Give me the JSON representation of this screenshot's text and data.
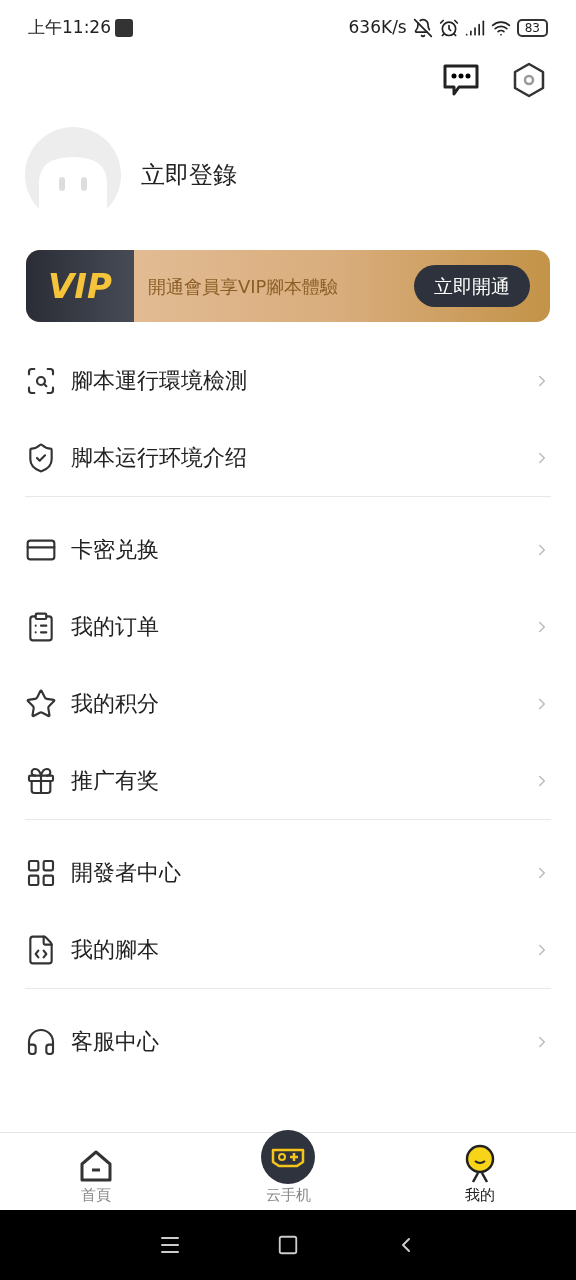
{
  "status_bar": {
    "time": "上午11:26",
    "speed": "636K/s",
    "battery": "83"
  },
  "profile": {
    "login_label": "立即登錄"
  },
  "vip_banner": {
    "badge": "VIP",
    "text": "開通會員享VIP腳本體驗",
    "button": "立即開通"
  },
  "menu_groups": [
    {
      "items": [
        {
          "kind": "scan",
          "label": "腳本運行環境檢測"
        },
        {
          "kind": "shield",
          "label": "脚本运行环境介绍"
        }
      ]
    },
    {
      "items": [
        {
          "kind": "card",
          "label": "卡密兑换"
        },
        {
          "kind": "clipboard",
          "label": "我的订单"
        },
        {
          "kind": "points",
          "label": "我的积分"
        },
        {
          "kind": "gift",
          "label": "推广有奖"
        }
      ]
    },
    {
      "items": [
        {
          "kind": "grid",
          "label": "開發者中心"
        },
        {
          "kind": "code",
          "label": "我的腳本"
        }
      ]
    },
    {
      "items": [
        {
          "kind": "headset",
          "label": "客服中心"
        }
      ]
    }
  ],
  "bottom_nav": [
    {
      "kind": "home",
      "label": "首頁",
      "selected": false
    },
    {
      "kind": "cloud",
      "label": "云手机",
      "selected": false
    },
    {
      "kind": "me",
      "label": "我的",
      "selected": true
    }
  ]
}
